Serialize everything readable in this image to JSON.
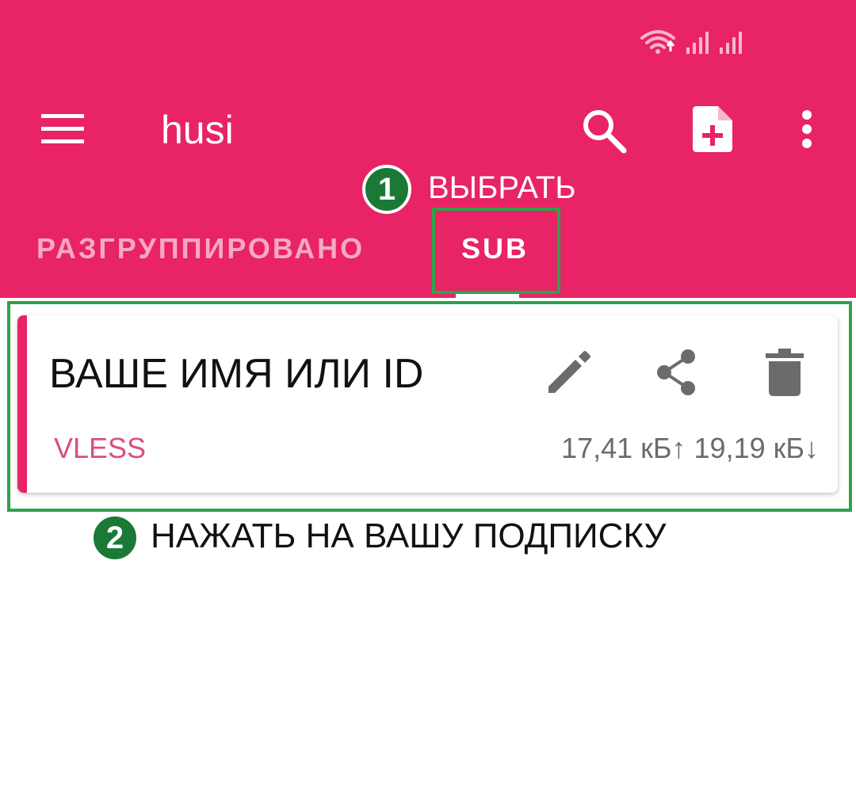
{
  "app": {
    "title": "husi",
    "accent_color": "#e82366",
    "highlight_color": "#2ea24a",
    "badge_color": "#1a7a35"
  },
  "status_bar": {
    "icons": [
      "wifi-icon",
      "signal-icon",
      "signal-icon"
    ]
  },
  "toolbar": {
    "icons": [
      "menu-icon",
      "search-icon",
      "add-file-icon",
      "more-vert-icon"
    ]
  },
  "annotations": {
    "step1": {
      "number": "1",
      "text": "ВЫБРАТЬ"
    },
    "step2": {
      "number": "2",
      "text": "НАЖАТЬ НА ВАШУ ПОДПИСКУ"
    }
  },
  "tabs": [
    {
      "label": "РАЗГРУППИРОВАНО",
      "selected": false
    },
    {
      "label": "SUB",
      "selected": true
    }
  ],
  "profile_card": {
    "name": "ВАШЕ ИМЯ ИЛИ ID",
    "type": "VLESS",
    "traffic": "17,41 кБ↑ 19,19 кБ↓",
    "actions": [
      "edit-icon",
      "share-icon",
      "delete-icon"
    ]
  }
}
